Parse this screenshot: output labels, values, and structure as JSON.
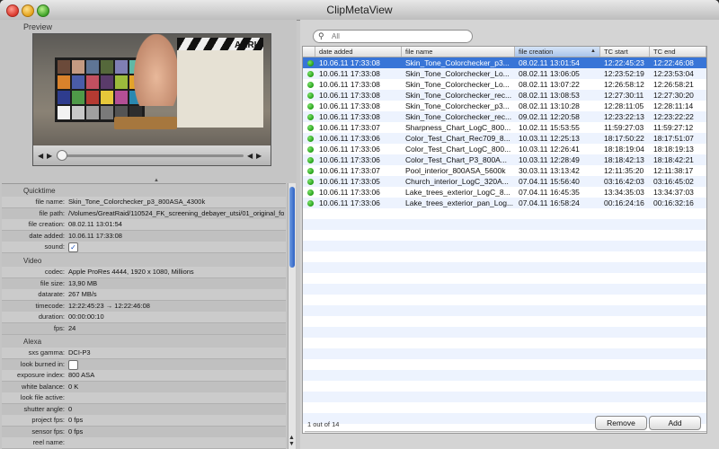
{
  "window": {
    "title": "ClipMetaView"
  },
  "preview": {
    "label": "Preview",
    "clapper_logo": "ARRI",
    "chart_colors": [
      "#6b4a3a",
      "#c49a82",
      "#5f7595",
      "#55683b",
      "#7f7fb4",
      "#5fb8a6",
      "#d9822b",
      "#4a5ca8",
      "#c25060",
      "#5a3b6a",
      "#9cbb3c",
      "#e3a32a",
      "#2e3c8e",
      "#4f9a48",
      "#b53a32",
      "#e6c73a",
      "#b34f95",
      "#2a88b0",
      "#f2f2f2",
      "#c8c8c8",
      "#a0a0a0",
      "#7a7a7a",
      "#545454",
      "#2e2e2e"
    ]
  },
  "sections": {
    "quicktime": "Quicktime",
    "video": "Video",
    "alexa": "Alexa"
  },
  "quicktime": [
    {
      "label": "file name:",
      "value": "Skin_Tone_Colorchecker_p3_800ASA_4300k"
    },
    {
      "label": "file path:",
      "value": "/Volumes/GreatRaid/110524_FK_screening_debayer_utsi/01_original_fo..."
    },
    {
      "label": "file creation:",
      "value": "08.02.11 13:01:54"
    },
    {
      "label": "date added:",
      "value": "10.06.11 17:33:08"
    },
    {
      "label": "sound:",
      "value": "✓",
      "checkbox": true
    }
  ],
  "video": [
    {
      "label": "codec:",
      "value": "Apple ProRes 4444, 1920 x 1080, Millions"
    },
    {
      "label": "file size:",
      "value": "13,90 MB"
    },
    {
      "label": "datarate:",
      "value": "267 MB/s"
    },
    {
      "label": "timecode:",
      "value": "12:22:45:23 → 12:22:46:08"
    },
    {
      "label": "duration:",
      "value": "00:00:00:10"
    },
    {
      "label": "fps:",
      "value": "24"
    }
  ],
  "alexa": [
    {
      "label": "sxs gamma:",
      "value": "DCI-P3"
    },
    {
      "label": "look burned in:",
      "value": "",
      "checkbox": true
    },
    {
      "label": "exposure index:",
      "value": "800 ASA"
    },
    {
      "label": "white balance:",
      "value": "0 K"
    },
    {
      "label": "look file active:",
      "value": ""
    },
    {
      "label": "shutter angle:",
      "value": "0"
    },
    {
      "label": "project fps:",
      "value": "0 fps"
    },
    {
      "label": "sensor fps:",
      "value": "0 fps"
    },
    {
      "label": "reel name:",
      "value": ""
    }
  ],
  "search": {
    "placeholder": "All",
    "icon": "magnifier-icon"
  },
  "table": {
    "columns": [
      "date added",
      "file name",
      "file creation",
      "TC start",
      "TC end"
    ],
    "sorted_column": "file creation",
    "rows": [
      [
        "10.06.11 17:33:08",
        "Skin_Tone_Colorchecker_p3...",
        "08.02.11 13:01:54",
        "12:22:45:23",
        "12:22:46:08"
      ],
      [
        "10.06.11 17:33:08",
        "Skin_Tone_Colorchecker_Lo...",
        "08.02.11 13:06:05",
        "12:23:52:19",
        "12:23:53:04"
      ],
      [
        "10.06.11 17:33:08",
        "Skin_Tone_Colorchecker_Lo...",
        "08.02.11 13:07:22",
        "12:26:58:12",
        "12:26:58:21"
      ],
      [
        "10.06.11 17:33:08",
        "Skin_Tone_Colorchecker_rec...",
        "08.02.11 13:08:53",
        "12:27:30:11",
        "12:27:30:20"
      ],
      [
        "10.06.11 17:33:08",
        "Skin_Tone_Colorchecker_p3...",
        "08.02.11 13:10:28",
        "12:28:11:05",
        "12:28:11:14"
      ],
      [
        "10.06.11 17:33:08",
        "Skin_Tone_Colorchecker_rec...",
        "09.02.11 12:20:58",
        "12:23:22:13",
        "12:23:22:22"
      ],
      [
        "10.06.11 17:33:07",
        "Sharpness_Chart_LogC_800...",
        "10.02.11 15:53:55",
        "11:59:27:03",
        "11:59:27:12"
      ],
      [
        "10.06.11 17:33:06",
        "Color_Test_Chart_Rec709_8...",
        "10.03.11 12:25:13",
        "18:17:50:22",
        "18:17:51:07"
      ],
      [
        "10.06.11 17:33:06",
        "Color_Test_Chart_LogC_800...",
        "10.03.11 12:26:41",
        "18:18:19:04",
        "18:18:19:13"
      ],
      [
        "10.06.11 17:33:06",
        "Color_Test_Chart_P3_800A...",
        "10.03.11 12:28:49",
        "18:18:42:13",
        "18:18:42:21"
      ],
      [
        "10.06.11 17:33:07",
        "Pool_interior_800ASA_5600k",
        "30.03.11 13:13:42",
        "12:11:35:20",
        "12:11:38:17"
      ],
      [
        "10.06.11 17:33:05",
        "Church_interior_LogC_320A...",
        "07.04.11 15:56:40",
        "03:16:42:03",
        "03:16:45:02"
      ],
      [
        "10.06.11 17:33:06",
        "Lake_trees_exterior_LogC_8...",
        "07.04.11 16:45:35",
        "13:34:35:03",
        "13:34:37:03"
      ],
      [
        "10.06.11 17:33:06",
        "Lake_trees_exterior_pan_Log...",
        "07.04.11 16:58:24",
        "00:16:24:16",
        "00:16:32:16"
      ]
    ]
  },
  "footer": {
    "count": "1 out of 14",
    "remove_label": "Remove",
    "add_label": "Add"
  },
  "colors": {
    "selection": "#3875d7",
    "status_ok": "#1d9b12"
  }
}
